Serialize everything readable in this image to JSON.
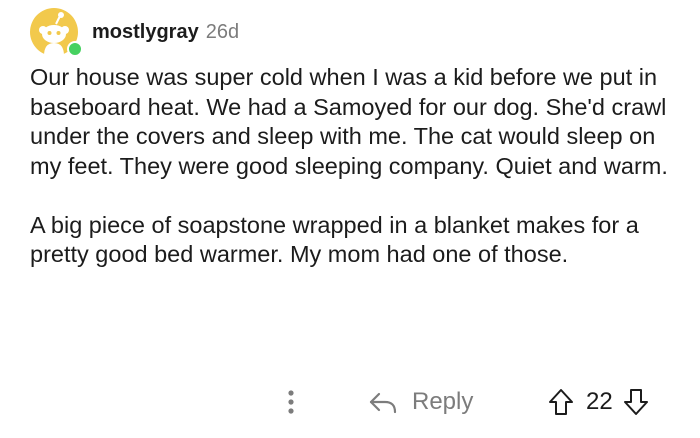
{
  "comment": {
    "username": "mostlygray",
    "age": "26d",
    "paragraphs": [
      "Our house was super cold when I was a kid before we put in baseboard heat.  We had a Samoyed for our dog.  She'd crawl under the covers and sleep with me.  The cat would sleep on my feet.  They were good sleeping company.  Quiet and warm.",
      "A big piece of soapstone wrapped in a blanket makes for a pretty good bed warmer.  My mom had one of those."
    ],
    "avatar_icon": "reddit-snoo-icon",
    "avatar_color": "#f2c94c",
    "online_color": "#46d160"
  },
  "actions": {
    "reply_label": "Reply",
    "score": "22",
    "more_icon": "more-vertical-icon",
    "reply_icon": "reply-arrow-icon",
    "upvote_icon": "upvote-arrow-icon",
    "downvote_icon": "downvote-arrow-icon"
  }
}
